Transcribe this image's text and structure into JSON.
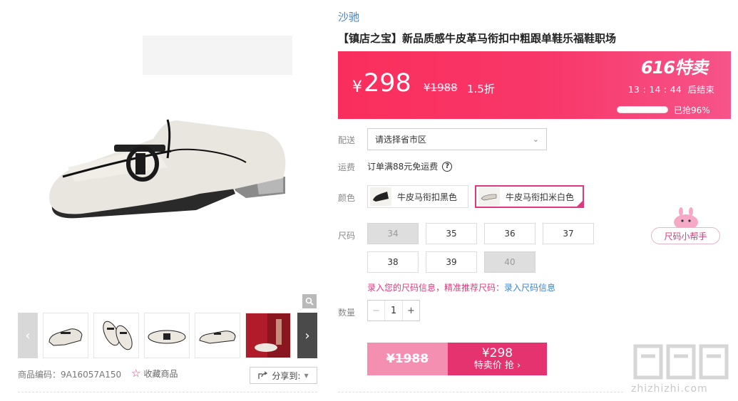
{
  "product": {
    "brand": "沙驰",
    "title": "【镇店之宝】新品质感牛皮革马衔扣中粗跟单鞋乐福鞋职场"
  },
  "price_bar": {
    "currency": "¥",
    "price": "298",
    "original_price": "¥1988",
    "discount": "1.5折",
    "sale_tag": "616特卖",
    "timer": "13 : 14 : 44",
    "timer_suffix": "后结束",
    "sold_text": "已抢96%",
    "sold_progress": 0.96,
    "gradient_start": "#fa2e5c",
    "gradient_end": "#f6548a"
  },
  "delivery": {
    "label": "配送",
    "placeholder": "请选择省市区"
  },
  "shipping": {
    "label": "运费",
    "text": "订单满88元免运费"
  },
  "colors": {
    "label": "颜色",
    "options": [
      {
        "name": "牛皮马衔扣黑色",
        "selected": false
      },
      {
        "name": "牛皮马衔扣米白色",
        "selected": true
      }
    ]
  },
  "sizes": {
    "label": "尺码",
    "options": [
      {
        "value": "34",
        "available": false
      },
      {
        "value": "35",
        "available": true
      },
      {
        "value": "36",
        "available": true
      },
      {
        "value": "37",
        "available": true
      },
      {
        "value": "38",
        "available": true
      },
      {
        "value": "39",
        "available": true
      },
      {
        "value": "40",
        "available": false
      }
    ],
    "helper": "尺码小帮手",
    "tip_text": "录入您的尺码信息，精准推荐尺码：",
    "tip_link": "录入尺码信息"
  },
  "quantity": {
    "label": "数量",
    "value": "1",
    "minus": "−",
    "plus": "+"
  },
  "buy": {
    "original": "¥1988",
    "price": "¥298",
    "action": "特卖价 抢 ›"
  },
  "gallery": {
    "product_code": "商品编码：9A16057A150",
    "favorite": "收藏商品",
    "share": "分享到:",
    "prev": "‹",
    "next": "›"
  },
  "watermark": {
    "text": "zhizhizhi.com"
  },
  "accent_color": "#e0387e",
  "link_color": "#3b84d0"
}
